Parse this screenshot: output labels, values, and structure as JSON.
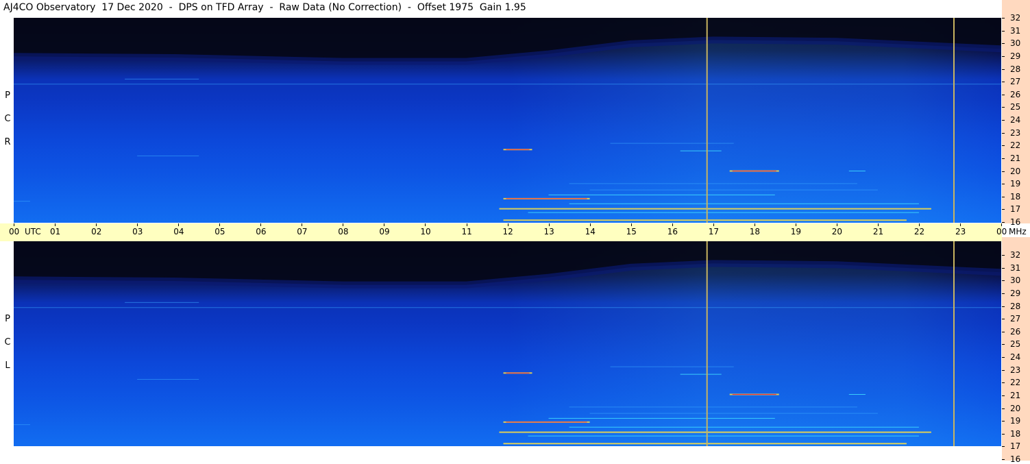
{
  "title": "AJ4CO Observatory  17 Dec 2020  -  DPS on TFD Array  -  Raw Data (No Correction)  -  Offset 1975  Gain 1.95",
  "time_axis": {
    "unit": "UTC",
    "freq_unit": "MHz",
    "hours": [
      "00",
      "01",
      "02",
      "03",
      "04",
      "05",
      "06",
      "07",
      "08",
      "09",
      "10",
      "11",
      "12",
      "13",
      "14",
      "15",
      "16",
      "17",
      "18",
      "19",
      "20",
      "21",
      "22",
      "23",
      "00"
    ]
  },
  "freq_labels": [
    "32",
    "31",
    "30",
    "29",
    "28",
    "27",
    "26",
    "25",
    "24",
    "23",
    "22",
    "21",
    "20",
    "19",
    "18",
    "17",
    "16"
  ],
  "panels": [
    {
      "id": "rcp",
      "label": [
        "R",
        "C",
        "P"
      ]
    },
    {
      "id": "lcp",
      "label": [
        "L",
        "C",
        "P"
      ]
    }
  ],
  "colors": {
    "background_low": "#050818",
    "background_mid": "#0b32b8",
    "background_high": "#0d52ee",
    "signal_cyan": "#40e0ff",
    "signal_yellow": "#ffe040",
    "signal_red": "#ff3030",
    "marker_line": "#c8b460",
    "freq_axis_bg": "#ffd9bf",
    "time_axis_bg": "#ffffc0"
  },
  "chart_data": {
    "type": "heatmap",
    "title": "AJ4CO Observatory  17 Dec 2020  -  DPS on TFD Array  -  Raw Data (No Correction)  -  Offset 1975  Gain 1.95",
    "x_unit": "UTC",
    "y_unit": "MHz",
    "xlim": [
      0,
      24
    ],
    "ylim": [
      16,
      32
    ],
    "markers_utc": [
      16.85,
      22.85
    ],
    "panels": [
      "RCP",
      "LCP"
    ],
    "cutoff_profile": [
      {
        "utc": 0,
        "mhz": 29.1
      },
      {
        "utc": 4,
        "mhz": 29.0
      },
      {
        "utc": 8,
        "mhz": 28.7
      },
      {
        "utc": 11,
        "mhz": 28.7
      },
      {
        "utc": 13,
        "mhz": 29.3
      },
      {
        "utc": 15,
        "mhz": 30.1
      },
      {
        "utc": 17,
        "mhz": 30.4
      },
      {
        "utc": 20,
        "mhz": 30.3
      },
      {
        "utc": 24,
        "mhz": 29.7
      }
    ],
    "interference_lines": [
      {
        "mhz": 17.0,
        "utc_start": 11.8,
        "utc_end": 22.3,
        "intensity": "high"
      },
      {
        "mhz": 17.8,
        "utc_start": 11.9,
        "utc_end": 14.0,
        "intensity": "high"
      },
      {
        "mhz": 16.1,
        "utc_start": 11.9,
        "utc_end": 21.7,
        "intensity": "high"
      },
      {
        "mhz": 16.7,
        "utc_start": 12.5,
        "utc_end": 22.0,
        "intensity": "medium"
      },
      {
        "mhz": 17.4,
        "utc_start": 13.5,
        "utc_end": 22.0,
        "intensity": "medium"
      },
      {
        "mhz": 18.1,
        "utc_start": 13.0,
        "utc_end": 18.5,
        "intensity": "medium"
      },
      {
        "mhz": 18.5,
        "utc_start": 14.0,
        "utc_end": 21.0,
        "intensity": "low"
      },
      {
        "mhz": 19.0,
        "utc_start": 13.5,
        "utc_end": 20.5,
        "intensity": "low"
      },
      {
        "mhz": 20.0,
        "utc_start": 17.4,
        "utc_end": 18.6,
        "intensity": "high"
      },
      {
        "mhz": 20.0,
        "utc_start": 20.3,
        "utc_end": 20.7,
        "intensity": "medium"
      },
      {
        "mhz": 21.7,
        "utc_start": 11.9,
        "utc_end": 12.6,
        "intensity": "high"
      },
      {
        "mhz": 21.6,
        "utc_start": 16.2,
        "utc_end": 17.2,
        "intensity": "medium"
      },
      {
        "mhz": 22.2,
        "utc_start": 14.5,
        "utc_end": 17.5,
        "intensity": "low"
      },
      {
        "mhz": 21.2,
        "utc_start": 3.0,
        "utc_end": 4.5,
        "intensity": "low"
      },
      {
        "mhz": 17.6,
        "utc_start": 0.0,
        "utc_end": 0.4,
        "intensity": "low"
      },
      {
        "mhz": 26.9,
        "utc_start": 0.0,
        "utc_end": 24.0,
        "intensity": "low"
      },
      {
        "mhz": 27.3,
        "utc_start": 2.7,
        "utc_end": 4.5,
        "intensity": "low"
      }
    ]
  }
}
